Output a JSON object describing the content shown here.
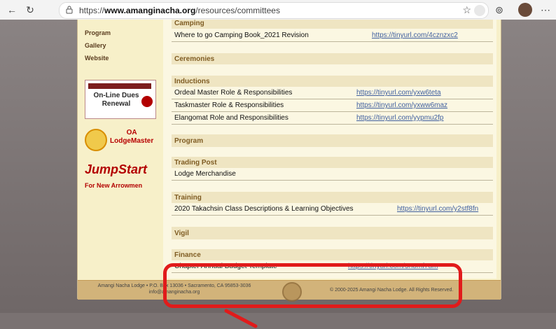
{
  "browser": {
    "url_prefix": "https://",
    "url_domain": "www.amanginacha.org",
    "url_path": "/resources/committees"
  },
  "sidebar": {
    "links": [
      "Program",
      "Gallery",
      "Website"
    ],
    "promo_1_line1": "On-Line Dues",
    "promo_1_line2": "Renewal",
    "promo_2_line1": "OA",
    "promo_2_line2": "LodgeMaster",
    "promo_3_line1": "JumpStart",
    "promo_3_line2": "For New Arrowmen"
  },
  "content": {
    "camping_title": "Camping",
    "camping_item": "Where to go Camping Book_2021 Revision",
    "camping_link": "https://tinyurl.com/4cznzxc2",
    "ceremonies_title": "Ceremonies",
    "inductions_title": "Inductions",
    "inductions_items": [
      {
        "title": "Ordeal Master Role & Responsibilities",
        "link": "https://tinyurl.com/yxw6teta"
      },
      {
        "title": "Taskmaster Role & Responsibilities",
        "link": "https://tinyurl.com/yxww6maz"
      },
      {
        "title": "Elangomat Role and Responsibilities",
        "link": "https://tinyurl.com/yypmu2fp"
      }
    ],
    "program_title": "Program",
    "trading_post_title": "Trading Post",
    "trading_post_item": "Lodge Merchandise",
    "training_title": "Training",
    "training_item": "2020 Takachsin Class Descriptions & Learning Objectives",
    "training_link": "https://tinyurl.com/y2stf8fn",
    "vigil_title": "Vigil",
    "finance_title": "Finance",
    "finance_item": "Chapter Annual Budget Template",
    "finance_link": "https://tinyurl.com/5n8mf7um"
  },
  "footer": {
    "left_line1": "Amangi Nacha Lodge • P.O. Box 13036 • Sacramento, CA 95853-3036",
    "left_line2": "info@amanginacha.org",
    "right": "© 2000-2025 Amangi Nacha Lodge. All Rights Reserved."
  },
  "colors": {
    "highlight": "#e11b1b",
    "page_bg": "#f7f0c9",
    "section_header": "#efe5c2",
    "link": "#3f5f9f"
  }
}
